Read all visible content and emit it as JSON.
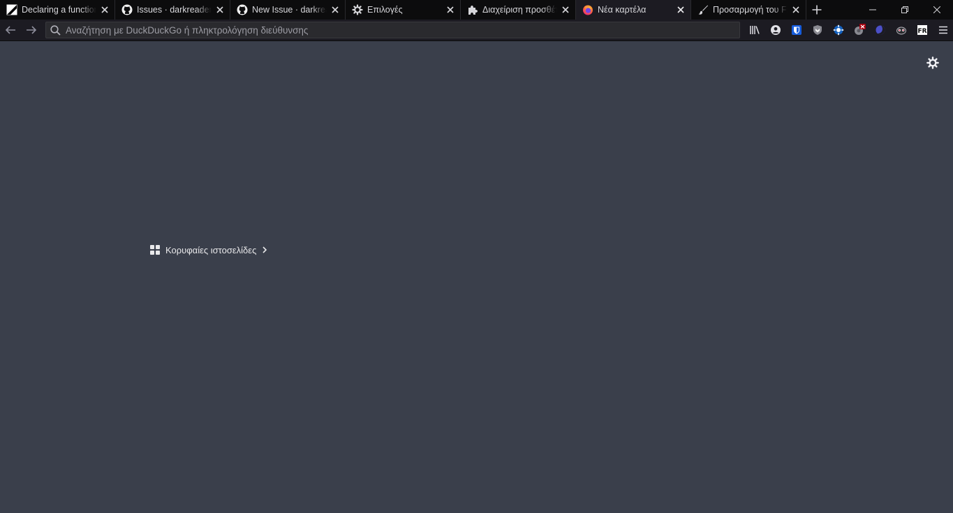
{
  "tabs": [
    {
      "title": "Declaring a function",
      "icon": "zed-icon"
    },
    {
      "title": "Issues · darkreader/darkreader",
      "icon": "github-icon"
    },
    {
      "title": "New Issue · darkreader/darkreader",
      "icon": "github-icon"
    },
    {
      "title": "Επιλογές",
      "icon": "gear-icon"
    },
    {
      "title": "Διαχείριση προσθέτων",
      "icon": "puzzle-icon"
    },
    {
      "title": "Νέα καρτέλα",
      "icon": "firefox-icon",
      "active": true
    },
    {
      "title": "Προσαρμογή του Firefox",
      "icon": "brush-icon"
    }
  ],
  "urlbar": {
    "placeholder": "Αναζήτηση με DuckDuckGo ή πληκτρολόγηση διεύθυνσης"
  },
  "toolbar_icons": [
    "library-icon",
    "account-icon",
    "bitwarden-icon",
    "privacy-badger-icon",
    "ublock-icon",
    "disabled-extension-icon",
    "darkreader-icon",
    "extension-face-icon",
    "fr-icon",
    "menu-icon"
  ],
  "newtab": {
    "topsites_label": "Κορυφαίες ιστοσελίδες"
  },
  "colors": {
    "page_background": "#3a3f4b",
    "tabstrip": "#0c0c0d",
    "toolbar": "#1c1b22"
  }
}
